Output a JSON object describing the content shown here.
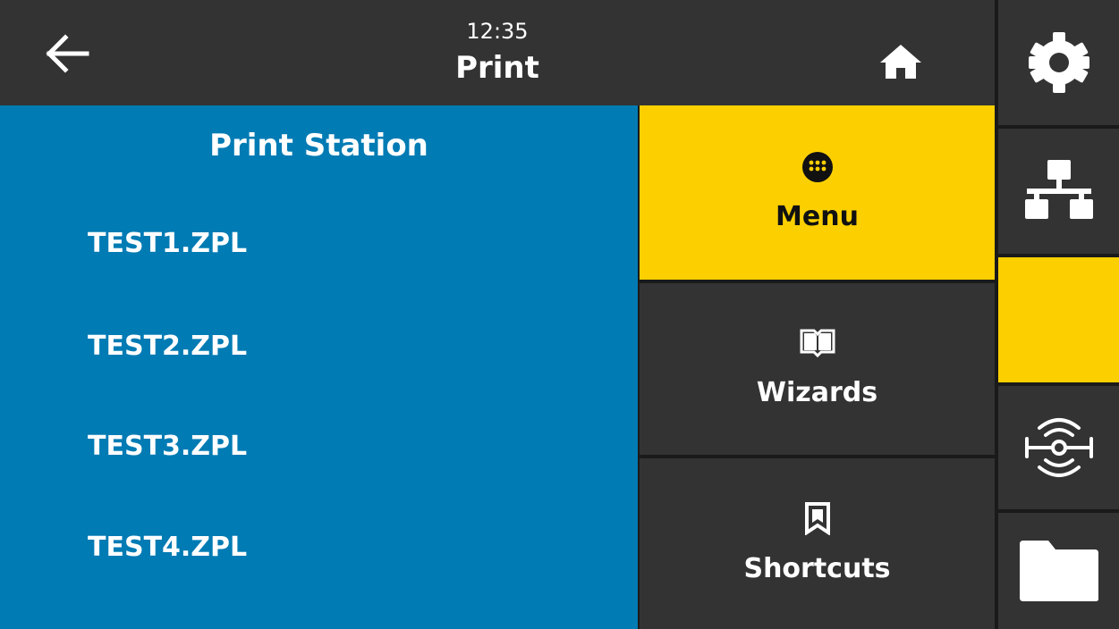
{
  "header": {
    "time": "12:35",
    "title": "Print",
    "back_icon": "arrow-left-icon",
    "home_icon": "home-icon"
  },
  "station": {
    "title": "Print Station",
    "files": [
      "TEST1.ZPL",
      "TEST2.ZPL",
      "TEST3.ZPL",
      "TEST4.ZPL"
    ]
  },
  "nav": {
    "menu_label": "Menu",
    "menu_icon": "dots-grid-icon",
    "wizards_label": "Wizards",
    "wizards_icon": "book-icon",
    "shortcuts_label": "Shortcuts",
    "shortcuts_icon": "bookmark-icon"
  },
  "sidebar": {
    "items": [
      {
        "name": "settings",
        "icon": "gear-icon"
      },
      {
        "name": "network",
        "icon": "network-icon"
      },
      {
        "name": "print",
        "icon": "none"
      },
      {
        "name": "rfid",
        "icon": "rfid-icon"
      },
      {
        "name": "files",
        "icon": "folder-icon"
      }
    ]
  },
  "colors": {
    "header_bg": "#333333",
    "panel_blue": "#007bb4",
    "accent_yellow": "#fcd000",
    "dark_tile": "#333333",
    "text_light": "#ffffff"
  }
}
